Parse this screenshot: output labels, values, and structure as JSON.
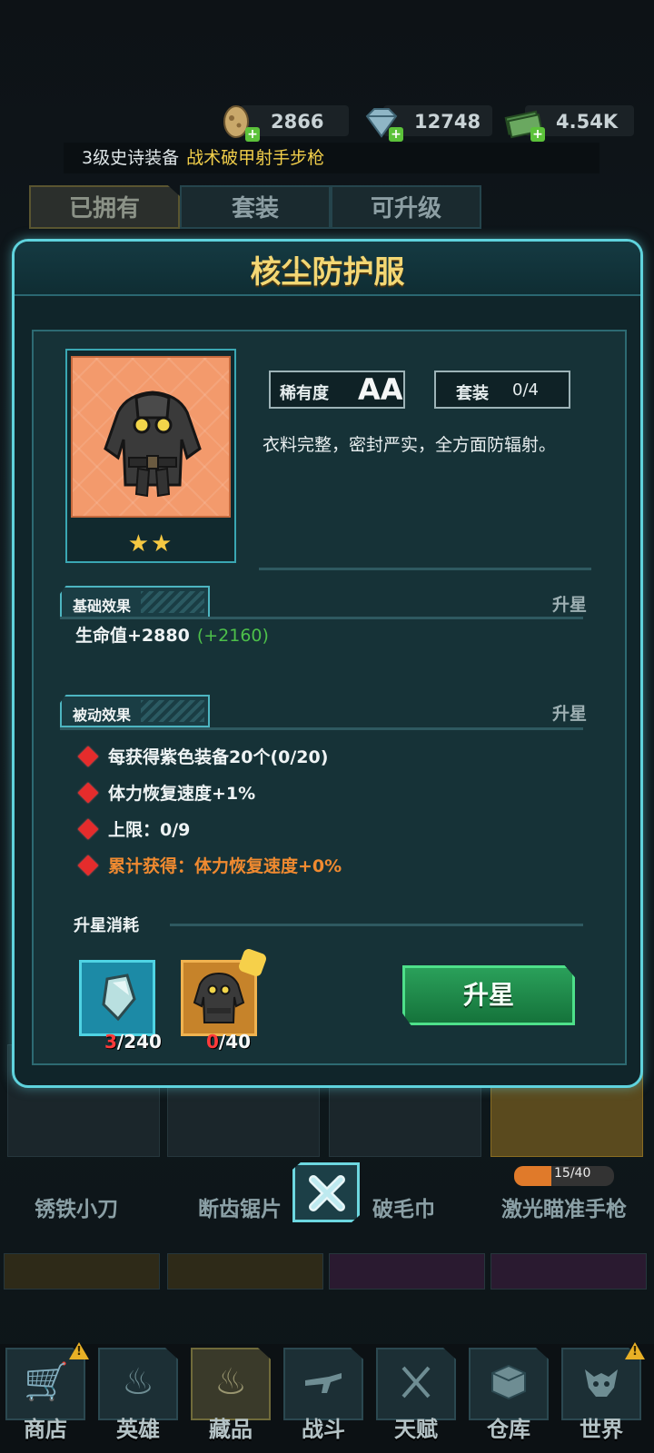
{
  "currencies": [
    {
      "icon": "egg-icon",
      "value": "2866"
    },
    {
      "icon": "diamond-icon",
      "value": "12748"
    },
    {
      "icon": "cash-icon",
      "value": "4.54K"
    }
  ],
  "ticker": {
    "prefix": "3级史诗装备",
    "item": "战术破甲射手步枪"
  },
  "tabs": [
    "已拥有",
    "套装",
    "可升级"
  ],
  "background_items": [
    {
      "name": "锈铁小刀"
    },
    {
      "name": "断齿锯片"
    },
    {
      "name": "破毛巾"
    },
    {
      "name": "激光瞄准手枪",
      "progress": "15/40"
    }
  ],
  "modal": {
    "title": "核尘防护服",
    "stars": "★★",
    "rarity_label": "稀有度",
    "rarity_value": "AA",
    "set_label": "套装",
    "set_value": "0/4",
    "description": "衣料完整，密封严实，全方面防辐射。",
    "basic": {
      "tag": "基础效果",
      "link": "升星",
      "stat": "生命值+2880",
      "bonus": "(+2160)"
    },
    "passive": {
      "tag": "被动效果",
      "link": "升星",
      "rows": [
        "每获得紫色装备20个(0/20)",
        "体力恢复速度+1%",
        "上限：0/9",
        "累计获得：体力恢复速度+0%"
      ]
    },
    "cost": {
      "title": "升星消耗",
      "mat1_have": "3",
      "mat1_need": "/240",
      "mat2_have": "0",
      "mat2_need": "/40"
    },
    "upgrade_label": "升星"
  },
  "nav": [
    {
      "label": "商店",
      "icon": "cart-icon",
      "warn": true
    },
    {
      "label": "英雄",
      "icon": "flame-hero-icon",
      "warn": false
    },
    {
      "label": "藏品",
      "icon": "fire-icon",
      "warn": false,
      "active": true
    },
    {
      "label": "战斗",
      "icon": "rifle-icon",
      "warn": false
    },
    {
      "label": "天赋",
      "icon": "dna-icon",
      "warn": false
    },
    {
      "label": "仓库",
      "icon": "crate-icon",
      "warn": false
    },
    {
      "label": "世界",
      "icon": "skull-icon",
      "warn": true
    }
  ],
  "colors": {
    "accent": "#5fd3dd",
    "title_gold": "#f3d774",
    "bonus_green": "#4dc04a",
    "warn_orange": "#f08a30"
  }
}
